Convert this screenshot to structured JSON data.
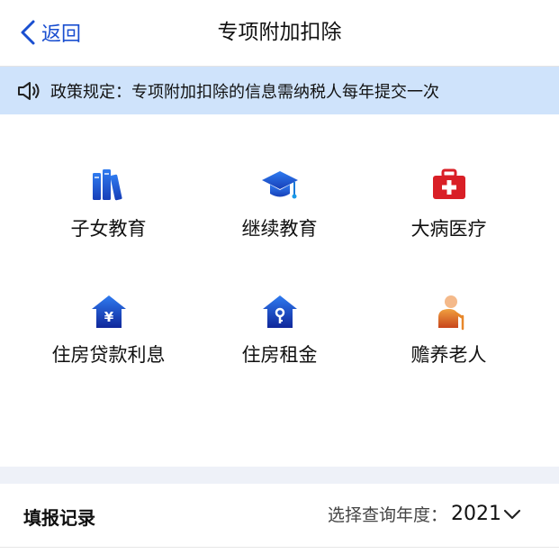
{
  "nav": {
    "back_label": "返回",
    "title": "专项附加扣除"
  },
  "notice": {
    "text": "政策规定：专项附加扣除的信息需纳税人每年提交一次"
  },
  "items": [
    {
      "label": "子女教育",
      "icon": "books-icon"
    },
    {
      "label": "继续教育",
      "icon": "graduation-cap-icon"
    },
    {
      "label": "大病医疗",
      "icon": "medical-kit-icon"
    },
    {
      "label": "住房贷款利息",
      "icon": "house-yuan-icon"
    },
    {
      "label": "住房租金",
      "icon": "house-key-icon"
    },
    {
      "label": "赡养老人",
      "icon": "elderly-person-icon"
    }
  ],
  "footer": {
    "records_label": "填报记录",
    "year_prompt": "选择查询年度：",
    "year_value": "2021"
  },
  "colors": {
    "accent": "#1a4fd0",
    "notice_bg": "#cfe3fb",
    "red": "#d91f26",
    "orange": "#e8872a"
  }
}
